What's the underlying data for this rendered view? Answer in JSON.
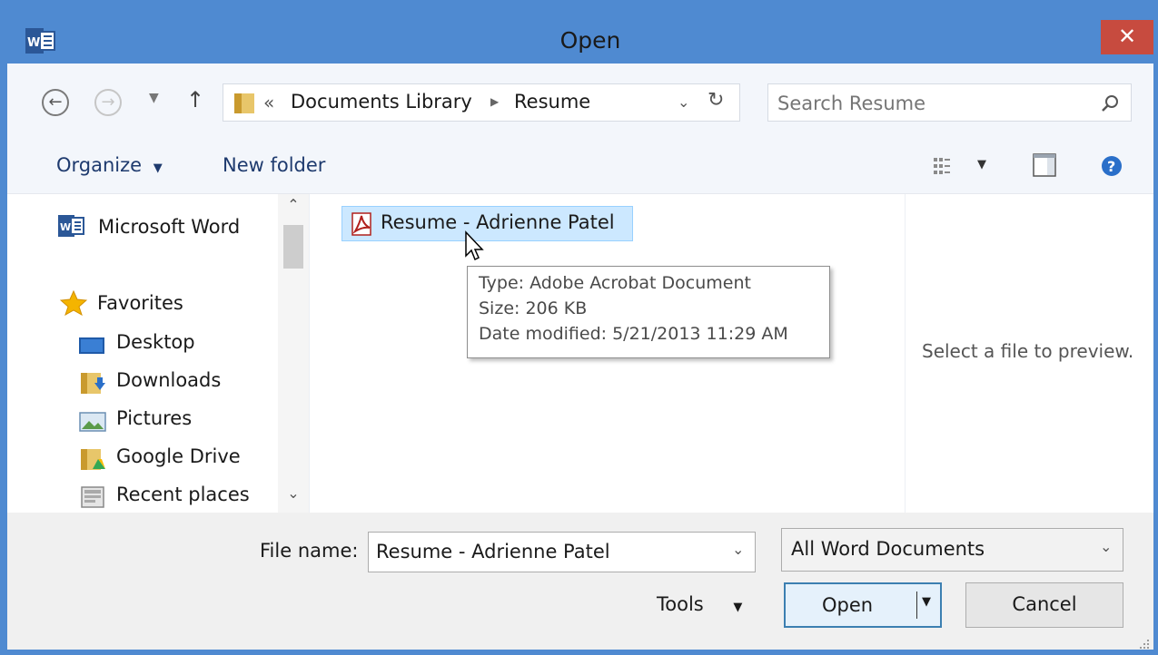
{
  "window": {
    "title": "Open",
    "app_icon": "word-icon",
    "close_label": "✕"
  },
  "navbar": {
    "breadcrumb": {
      "prefix": "«",
      "items": [
        "Documents Library",
        "Resume"
      ]
    },
    "search_placeholder": "Search Resume"
  },
  "toolbar": {
    "organize_label": "Organize",
    "new_folder_label": "New folder"
  },
  "sidebar": {
    "top_item": {
      "label": "Microsoft Word",
      "icon": "word-icon"
    },
    "favorites": {
      "label": "Favorites",
      "icon": "star-icon"
    },
    "items": [
      {
        "label": "Desktop",
        "icon": "desktop-icon"
      },
      {
        "label": "Downloads",
        "icon": "downloads-folder-icon"
      },
      {
        "label": "Pictures",
        "icon": "pictures-icon"
      },
      {
        "label": "Google Drive",
        "icon": "google-drive-folder-icon"
      },
      {
        "label": "Recent places",
        "icon": "recent-places-icon"
      }
    ]
  },
  "files": [
    {
      "name": "Resume - Adrienne Patel",
      "icon": "pdf-icon"
    }
  ],
  "tooltip": {
    "type": "Type: Adobe Acrobat Document",
    "size": "Size: 206 KB",
    "modified": "Date modified: 5/21/2013 11:29 AM"
  },
  "preview": {
    "text": "Select a file to preview."
  },
  "bottom": {
    "file_name_label": "File name:",
    "file_name_value": "Resume - Adrienne Patel",
    "filter_value": "All Word Documents",
    "tools_label": "Tools",
    "open_label": "Open",
    "cancel_label": "Cancel"
  },
  "colors": {
    "titlebar": "#4f8ad1",
    "close": "#c74b3f",
    "selection": "#cce8ff",
    "link": "#1e3a6e"
  }
}
